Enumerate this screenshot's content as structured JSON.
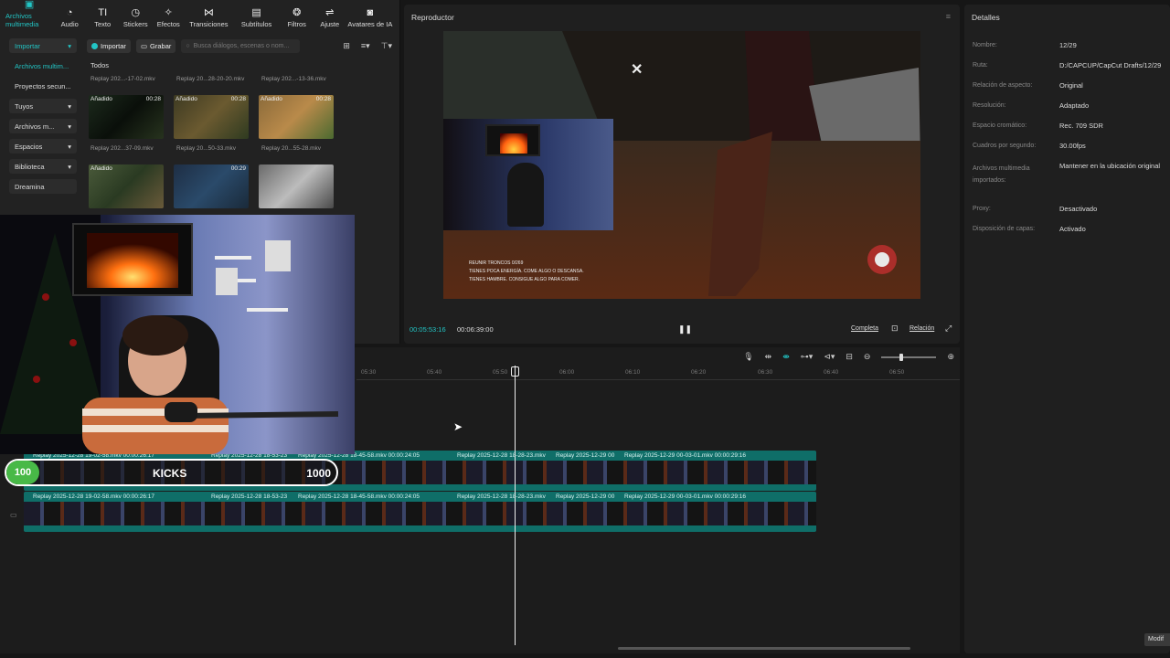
{
  "toolbar": {
    "items": [
      {
        "label": "Archivos multimedia",
        "icon": "media-icon"
      },
      {
        "label": "Audio",
        "icon": "audio-icon"
      },
      {
        "label": "Texto",
        "icon": "text-icon"
      },
      {
        "label": "Stickers",
        "icon": "sticker-icon"
      },
      {
        "label": "Efectos",
        "icon": "effects-icon"
      },
      {
        "label": "Transiciones",
        "icon": "transition-icon"
      },
      {
        "label": "Subtítulos",
        "icon": "subtitles-icon"
      },
      {
        "label": "Filtros",
        "icon": "filters-icon"
      },
      {
        "label": "Ajuste",
        "icon": "adjust-icon"
      },
      {
        "label": "Avatares de IA",
        "icon": "avatar-icon"
      }
    ]
  },
  "sidebar": {
    "items": [
      {
        "label": "Importar"
      },
      {
        "label": "Archivos multim..."
      },
      {
        "label": "Proyectos secun..."
      },
      {
        "label": "Tuyos"
      },
      {
        "label": "Archivos m..."
      },
      {
        "label": "Espacios"
      },
      {
        "label": "Biblioteca"
      },
      {
        "label": "Dreamina"
      }
    ]
  },
  "media": {
    "import_label": "Importar",
    "record_label": "Grabar",
    "search_placeholder": "Busca diálogos, escenas o nom...",
    "section": "Todos",
    "top_names": [
      "Replay 202...-17-02.mkv",
      "Replay 20...28-20-20.mkv",
      "Replay 202...-13-36.mkv"
    ],
    "row1": [
      {
        "tag": "Añadido",
        "dur": "00:28"
      },
      {
        "tag": "Añadido",
        "dur": "00:28"
      },
      {
        "tag": "Añadido",
        "dur": "00:28"
      }
    ],
    "row1_names": [
      "Replay 202...37-09.mkv",
      "Replay 20...50-33.mkv",
      "Replay 20...55-28.mkv"
    ],
    "row2": [
      {
        "tag": "Añadido",
        "dur": ""
      },
      {
        "tag": "",
        "dur": "00:29"
      },
      {
        "tag": "",
        "dur": ""
      }
    ]
  },
  "player": {
    "title": "Reproductor",
    "current": "00:05:53:16",
    "total": "00:06:39:00",
    "full_label": "Completa",
    "ratio_label": "Relación",
    "overlay_lines": [
      "REUNIR TRONCOS 0/269",
      "TIENES POCA ENERGÍA. COME ALGO O DESCANSA.",
      "TIENES HAMBRE. CONSIGUE ALGO PARA COMER."
    ]
  },
  "details": {
    "title": "Detalles",
    "rows": [
      {
        "k": "Nombre:",
        "v": "12/29"
      },
      {
        "k": "Ruta:",
        "v": "D:/CAPCUP/CapCut Drafts/12/29"
      },
      {
        "k": "Relación de aspecto:",
        "v": "Original"
      },
      {
        "k": "Resolución:",
        "v": "Adaptado"
      },
      {
        "k": "Espacio cromático:",
        "v": "Rec. 709 SDR"
      },
      {
        "k": "Cuadros por segundo:",
        "v": "30.00fps"
      },
      {
        "k": "Archivos multimedia importados:",
        "v": "Mantener en la ubicación original"
      },
      {
        "k": "Proxy:",
        "v": "Desactivado"
      },
      {
        "k": "Disposición de capas:",
        "v": "Activado"
      }
    ],
    "modify_label": "Modif"
  },
  "timeline": {
    "ticks": [
      "05:30",
      "05:40",
      "05:50",
      "06:00",
      "06:10",
      "06:20",
      "06:30",
      "06:40",
      "06:50"
    ],
    "track1_labels": [
      "Replay 2025-12-28 19-02-58.mkv   00:00:26:17",
      "Replay 2025-12-28 18-53-23",
      "Replay 2025-12-28 18-45-58.mkv   00:00:24:05",
      "Replay 2025-12-28 18-28-23.mkv",
      "Replay 2025-12-29 00",
      "Replay 2025-12-29 00-03-01.mkv   00:00:29:16"
    ],
    "track2_labels": [
      "Replay 2025-12-28 19-02-58.mkv   00:00:26:17",
      "Replay 2025-12-28 18-53-23",
      "Replay 2025-12-28 18-45-58.mkv   00:00:24:05",
      "Replay 2025-12-28 18-28-23.mkv",
      "Replay 2025-12-29 00",
      "Replay 2025-12-29 00-03-01.mkv   00:00:29:16"
    ]
  },
  "kicks": {
    "start": "100",
    "label": "KICKS",
    "end": "1000"
  },
  "colors": {
    "accent": "#22c5c5",
    "track": "#0f6e68",
    "kicks_green": "#48b947"
  }
}
